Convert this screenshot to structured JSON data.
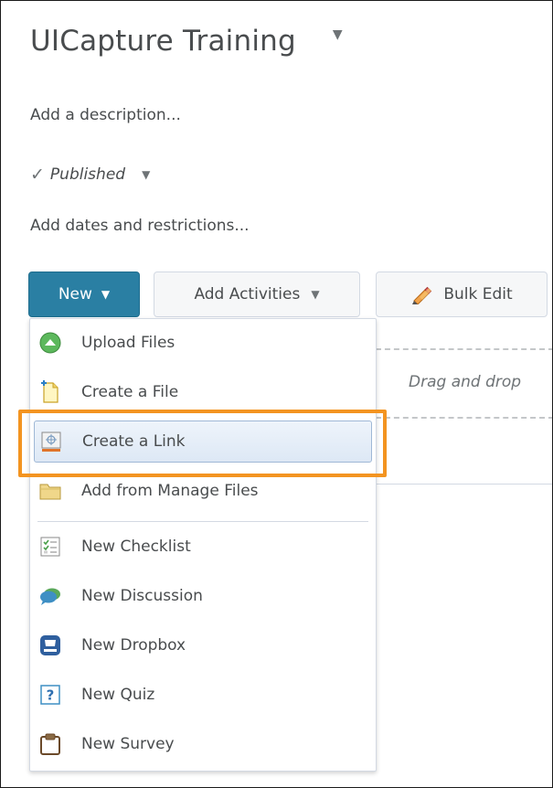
{
  "header": {
    "title": "UICapture Training"
  },
  "description_link": "Add a description...",
  "status": {
    "label": "Published"
  },
  "dates_link": "Add dates and restrictions...",
  "toolbar": {
    "new_label": "New",
    "add_activities_label": "Add Activities",
    "bulk_edit_label": "Bulk Edit"
  },
  "dropzone": {
    "text": "Drag and drop"
  },
  "new_menu": {
    "items": [
      {
        "label": "Upload Files",
        "icon": "upload-icon"
      },
      {
        "label": "Create a File",
        "icon": "new-file-icon"
      },
      {
        "label": "Create a Link",
        "icon": "link-icon",
        "selected": true
      },
      {
        "label": "Add from Manage Files",
        "icon": "folder-icon"
      },
      {
        "label": "New Checklist",
        "icon": "checklist-icon"
      },
      {
        "label": "New Discussion",
        "icon": "discussion-icon"
      },
      {
        "label": "New Dropbox",
        "icon": "dropbox-icon"
      },
      {
        "label": "New Quiz",
        "icon": "quiz-icon"
      },
      {
        "label": "New Survey",
        "icon": "survey-icon"
      }
    ]
  },
  "colors": {
    "primary_button": "#2a7fa3",
    "highlight_outline": "#f39421",
    "text": "#494c4e"
  }
}
